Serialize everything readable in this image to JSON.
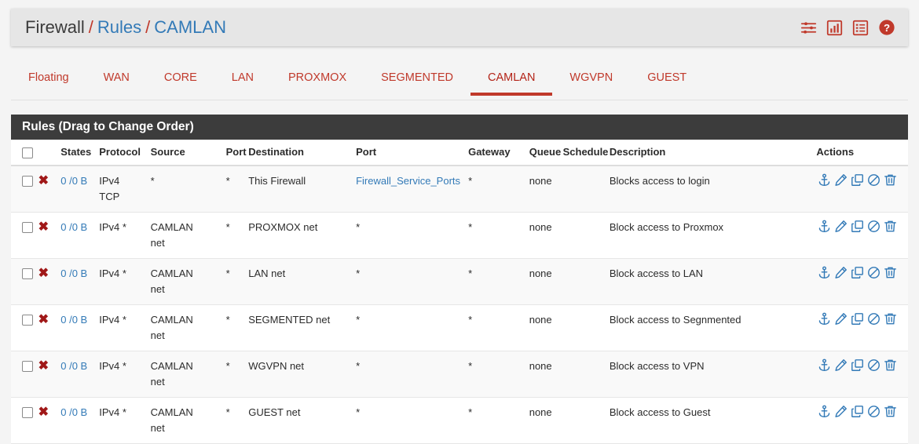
{
  "breadcrumb": {
    "root": "Firewall",
    "sep": "/",
    "level2": "Rules",
    "level3": "CAMLAN"
  },
  "header_icons": [
    {
      "name": "sliders-icon",
      "title": "Advanced"
    },
    {
      "name": "bar-chart-icon",
      "title": "Status"
    },
    {
      "name": "log-list-icon",
      "title": "Logs"
    },
    {
      "name": "help-circle-icon",
      "title": "Help"
    }
  ],
  "accent_colors": {
    "tab_red": "#c0392b",
    "link_blue": "#337ab7",
    "panel_dark": "#3c3c3c",
    "block_red": "#a01818",
    "action_blue": "#337ab7",
    "page_bg": "#f4f4f4",
    "card_bg": "#e6e6e6"
  },
  "tabs": [
    {
      "label": "Floating",
      "active": false
    },
    {
      "label": "WAN",
      "active": false
    },
    {
      "label": "CORE",
      "active": false
    },
    {
      "label": "LAN",
      "active": false
    },
    {
      "label": "PROXMOX",
      "active": false
    },
    {
      "label": "SEGMENTED",
      "active": false
    },
    {
      "label": "CAMLAN",
      "active": true
    },
    {
      "label": "WGVPN",
      "active": false
    },
    {
      "label": "GUEST",
      "active": false
    }
  ],
  "panel": {
    "title": "Rules (Drag to Change Order)"
  },
  "table": {
    "headers": {
      "check": "",
      "action": "",
      "states": "States",
      "protocol": "Protocol",
      "source": "Source",
      "source_port": "Port",
      "destination": "Destination",
      "dest_port": "Port",
      "gateway": "Gateway",
      "queue": "Queue",
      "schedule": "Schedule",
      "description": "Description",
      "actions": "Actions"
    },
    "row_action_icons": [
      {
        "name": "anchor-icon",
        "title": "Move"
      },
      {
        "name": "pencil-icon",
        "title": "Edit"
      },
      {
        "name": "copy-icon",
        "title": "Copy"
      },
      {
        "name": "ban-icon",
        "title": "Disable"
      },
      {
        "name": "trash-icon",
        "title": "Delete"
      }
    ],
    "rows": [
      {
        "action": "block",
        "states": "0 /0 B",
        "protocol_line1": "IPv4",
        "protocol_line2": "TCP",
        "source_line1": "*",
        "source_line2": "",
        "source_port": "*",
        "destination": "This Firewall",
        "dest_port": "Firewall_Service_Ports",
        "dest_port_is_link": true,
        "gateway": "*",
        "queue": "none",
        "schedule": "",
        "description": "Blocks access to login"
      },
      {
        "action": "block",
        "states": "0 /0 B",
        "protocol_line1": "IPv4 *",
        "protocol_line2": "",
        "source_line1": "CAMLAN",
        "source_line2": "net",
        "source_port": "*",
        "destination": "PROXMOX net",
        "dest_port": "*",
        "dest_port_is_link": false,
        "gateway": "*",
        "queue": "none",
        "schedule": "",
        "description": "Block access to Proxmox"
      },
      {
        "action": "block",
        "states": "0 /0 B",
        "protocol_line1": "IPv4 *",
        "protocol_line2": "",
        "source_line1": "CAMLAN",
        "source_line2": "net",
        "source_port": "*",
        "destination": "LAN net",
        "dest_port": "*",
        "dest_port_is_link": false,
        "gateway": "*",
        "queue": "none",
        "schedule": "",
        "description": "Block access to LAN"
      },
      {
        "action": "block",
        "states": "0 /0 B",
        "protocol_line1": "IPv4 *",
        "protocol_line2": "",
        "source_line1": "CAMLAN",
        "source_line2": "net",
        "source_port": "*",
        "destination": "SEGMENTED net",
        "dest_port": "*",
        "dest_port_is_link": false,
        "gateway": "*",
        "queue": "none",
        "schedule": "",
        "description": "Block access to Segnmented"
      },
      {
        "action": "block",
        "states": "0 /0 B",
        "protocol_line1": "IPv4 *",
        "protocol_line2": "",
        "source_line1": "CAMLAN",
        "source_line2": "net",
        "source_port": "*",
        "destination": "WGVPN net",
        "dest_port": "*",
        "dest_port_is_link": false,
        "gateway": "*",
        "queue": "none",
        "schedule": "",
        "description": "Block access to VPN"
      },
      {
        "action": "block",
        "states": "0 /0 B",
        "protocol_line1": "IPv4 *",
        "protocol_line2": "",
        "source_line1": "CAMLAN",
        "source_line2": "net",
        "source_port": "*",
        "destination": "GUEST net",
        "dest_port": "*",
        "dest_port_is_link": false,
        "gateway": "*",
        "queue": "none",
        "schedule": "",
        "description": "Block access to Guest"
      }
    ]
  }
}
